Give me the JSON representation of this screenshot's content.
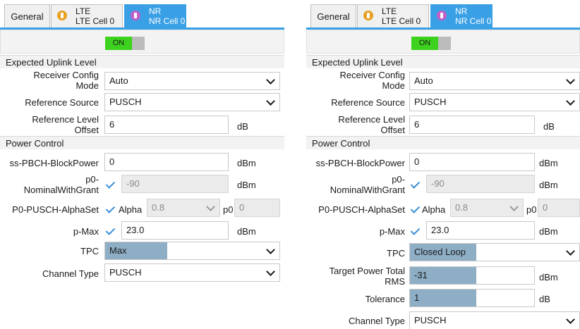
{
  "tabs": {
    "general": "General",
    "lte_line1": "LTE",
    "lte_line2": "LTE Cell 0",
    "nr_line1": "NR",
    "nr_line2": "NR Cell 0",
    "lte_icon": "lte-antenna-icon",
    "nr_icon": "nr-antenna-icon"
  },
  "toggle": {
    "label": "ON",
    "state": "on"
  },
  "sections": {
    "uplink": "Expected Uplink Level",
    "power": "Power Control"
  },
  "labels": {
    "receiver_config_1": "Receiver Config",
    "receiver_config_2": "Mode",
    "reference_source": "Reference Source",
    "ref_level_1": "Reference Level",
    "ref_level_2": "Offset",
    "ss_pbch": "ss-PBCH-BlockPower",
    "p0_1": "p0-",
    "p0_2": "NominalWithGrant",
    "p0_pusch": "P0-PUSCH-AlphaSet",
    "p_max": "p-Max",
    "tpc": "TPC",
    "channel_type": "Channel Type",
    "target_power_1": "Target Power Total",
    "target_power_2": "RMS",
    "tolerance": "Tolerance",
    "alpha": "Alpha",
    "p0_small": "p0"
  },
  "units": {
    "db": "dB",
    "dbm": "dBm"
  },
  "left": {
    "receiver_config_mode": "Auto",
    "reference_source": "PUSCH",
    "reference_level_offset": "6",
    "ss_pbch_block_power": "0",
    "p0_nominal_with_grant": "-90",
    "alpha_value": "0.8",
    "p0_value": "0",
    "p_max": "23.0",
    "tpc": "Max",
    "channel_type": "PUSCH"
  },
  "right": {
    "receiver_config_mode": "Auto",
    "reference_source": "PUSCH",
    "reference_level_offset": "6",
    "ss_pbch_block_power": "0",
    "p0_nominal_with_grant": "-90",
    "alpha_value": "0.8",
    "p0_value": "0",
    "p_max": "23.0",
    "tpc": "Closed Loop",
    "target_power_total_rms": "-31",
    "tolerance": "1",
    "channel_type": "PUSCH"
  },
  "colors": {
    "accent": "#3aa0e6",
    "toggle_on": "#3cd21e",
    "fill": "#8eaec6",
    "lte_icon": "#e8a020",
    "nr_icon": "#c060c8"
  }
}
